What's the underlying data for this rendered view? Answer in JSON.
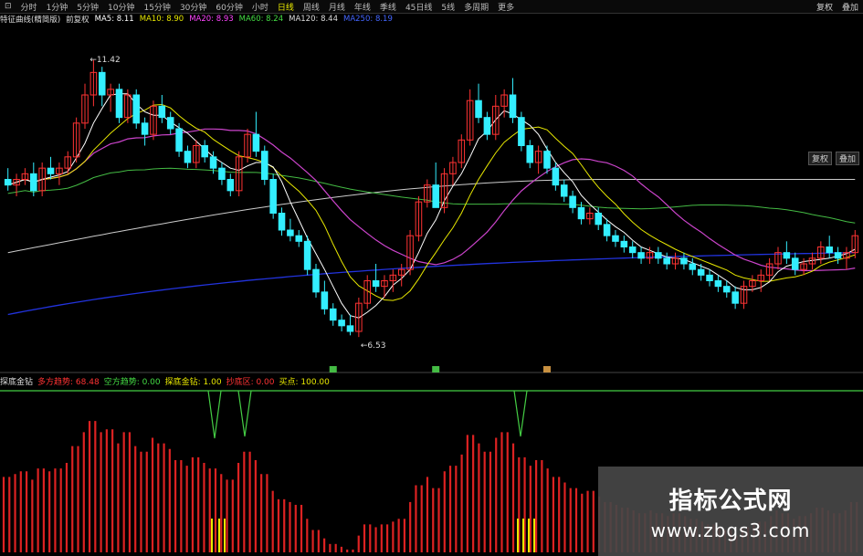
{
  "toolbar": {
    "items": [
      "⊡",
      "分时",
      "1分钟",
      "5分钟",
      "10分钟",
      "15分钟",
      "30分钟",
      "60分钟",
      "小时",
      "日线",
      "周线",
      "月线",
      "年线",
      "季线",
      "45日线",
      "5线",
      "多周期",
      "更多"
    ],
    "active_index": 9,
    "right_buttons": [
      "复权",
      "叠加"
    ]
  },
  "indicator_bar": {
    "items": [
      {
        "text": "特征曲线(精简版)",
        "color": "#dddddd"
      },
      {
        "text": "前复权",
        "color": "#dddddd"
      },
      {
        "text": "MA5: 8.11",
        "color": "#ffffff"
      },
      {
        "text": "MA10: 8.90",
        "color": "#e8e800"
      },
      {
        "text": "MA20: 8.93",
        "color": "#ff44ff"
      },
      {
        "text": "MA60: 8.24",
        "color": "#44dd44"
      },
      {
        "text": "MA120: 8.44",
        "color": "#dddddd"
      },
      {
        "text": "MA250: 8.19",
        "color": "#4466ff"
      }
    ]
  },
  "sub_bar": {
    "items": [
      {
        "text": "探底金钻",
        "color": "#dddddd"
      },
      {
        "text": "多方趋势: 68.48",
        "color": "#ff3333"
      },
      {
        "text": "空方趋势: 0.00",
        "color": "#44dd44"
      },
      {
        "text": "探底金钻: 1.00",
        "color": "#e8e800"
      },
      {
        "text": "抄底区: 0.00",
        "color": "#ff3333"
      },
      {
        "text": "买点: 100.00",
        "color": "#e8e800"
      }
    ]
  },
  "side_buttons": [
    "复权",
    "叠加"
  ],
  "annotations": {
    "high": "11.42",
    "low": "6.53"
  },
  "watermark": {
    "title": "指标公式网",
    "url": "www.zbgs3.com"
  },
  "colors": {
    "up": "#ff3333",
    "down": "#33eeff",
    "ma5": "#ffffff",
    "ma10": "#e8e800",
    "ma20": "#cc44cc",
    "ma60": "#44bb44",
    "ma120": "#cccccc",
    "ma250": "#2233dd",
    "bar": "#dd2222",
    "signal": "#e8e800",
    "topline": "#44cc44"
  },
  "chart_data": {
    "type": "candlestick",
    "price_range": [
      6.0,
      12.0
    ],
    "candles": [
      [
        9.3,
        9.5,
        9.1,
        9.2
      ],
      [
        9.2,
        9.4,
        9.0,
        9.3
      ],
      [
        9.3,
        9.5,
        9.2,
        9.4
      ],
      [
        9.4,
        9.6,
        9.0,
        9.1
      ],
      [
        9.1,
        9.6,
        9.0,
        9.5
      ],
      [
        9.5,
        9.7,
        9.3,
        9.4
      ],
      [
        9.4,
        9.6,
        9.2,
        9.5
      ],
      [
        9.5,
        9.8,
        9.4,
        9.7
      ],
      [
        9.7,
        10.4,
        9.6,
        10.3
      ],
      [
        10.3,
        11.0,
        10.2,
        10.8
      ],
      [
        10.8,
        11.42,
        10.6,
        11.2
      ],
      [
        11.2,
        11.3,
        10.6,
        10.8
      ],
      [
        10.8,
        11.0,
        10.5,
        10.9
      ],
      [
        10.9,
        11.0,
        10.3,
        10.4
      ],
      [
        10.4,
        10.9,
        10.3,
        10.8
      ],
      [
        10.8,
        10.9,
        10.2,
        10.3
      ],
      [
        10.3,
        10.4,
        9.9,
        10.1
      ],
      [
        10.1,
        10.7,
        10.0,
        10.6
      ],
      [
        10.6,
        10.8,
        10.3,
        10.4
      ],
      [
        10.4,
        10.5,
        10.1,
        10.2
      ],
      [
        10.2,
        10.3,
        9.7,
        9.8
      ],
      [
        9.8,
        9.9,
        9.5,
        9.6
      ],
      [
        9.6,
        10.0,
        9.5,
        9.9
      ],
      [
        9.9,
        10.0,
        9.6,
        9.7
      ],
      [
        9.7,
        9.8,
        9.4,
        9.5
      ],
      [
        9.5,
        9.6,
        9.2,
        9.3
      ],
      [
        9.3,
        9.4,
        9.0,
        9.1
      ],
      [
        9.1,
        9.8,
        9.0,
        9.7
      ],
      [
        9.7,
        10.2,
        9.6,
        10.1
      ],
      [
        10.1,
        10.5,
        9.7,
        9.8
      ],
      [
        9.8,
        9.9,
        9.2,
        9.3
      ],
      [
        9.3,
        9.4,
        8.6,
        8.7
      ],
      [
        8.7,
        8.8,
        8.3,
        8.4
      ],
      [
        8.4,
        8.6,
        8.2,
        8.3
      ],
      [
        8.3,
        8.4,
        8.1,
        8.2
      ],
      [
        8.2,
        8.3,
        7.6,
        7.7
      ],
      [
        7.7,
        7.8,
        7.2,
        7.3
      ],
      [
        7.3,
        7.5,
        6.9,
        7.0
      ],
      [
        7.0,
        7.1,
        6.7,
        6.8
      ],
      [
        6.8,
        6.9,
        6.6,
        6.7
      ],
      [
        6.7,
        6.9,
        6.53,
        6.6
      ],
      [
        6.6,
        7.2,
        6.5,
        7.1
      ],
      [
        7.1,
        7.6,
        7.0,
        7.5
      ],
      [
        7.5,
        7.8,
        7.3,
        7.4
      ],
      [
        7.4,
        7.6,
        7.2,
        7.5
      ],
      [
        7.5,
        7.7,
        7.3,
        7.6
      ],
      [
        7.6,
        7.8,
        7.4,
        7.7
      ],
      [
        7.7,
        8.4,
        7.6,
        8.3
      ],
      [
        8.3,
        9.0,
        8.2,
        8.9
      ],
      [
        8.9,
        9.3,
        8.8,
        9.2
      ],
      [
        9.2,
        9.6,
        9.0,
        8.8
      ],
      [
        8.8,
        9.5,
        8.7,
        9.4
      ],
      [
        9.4,
        9.7,
        9.2,
        9.6
      ],
      [
        9.6,
        10.1,
        9.5,
        10.0
      ],
      [
        10.0,
        10.9,
        9.9,
        10.7
      ],
      [
        10.7,
        11.0,
        10.3,
        10.4
      ],
      [
        10.4,
        10.5,
        10.0,
        10.1
      ],
      [
        10.1,
        10.8,
        10.0,
        10.6
      ],
      [
        10.6,
        10.9,
        10.4,
        10.8
      ],
      [
        10.8,
        11.1,
        10.3,
        10.4
      ],
      [
        10.4,
        10.5,
        9.8,
        9.9
      ],
      [
        9.9,
        10.0,
        9.5,
        9.6
      ],
      [
        9.6,
        9.9,
        9.4,
        9.8
      ],
      [
        9.8,
        9.9,
        9.4,
        9.5
      ],
      [
        9.5,
        9.6,
        9.1,
        9.2
      ],
      [
        9.2,
        9.3,
        8.9,
        9.0
      ],
      [
        9.0,
        9.1,
        8.7,
        8.8
      ],
      [
        8.8,
        8.9,
        8.5,
        8.6
      ],
      [
        8.6,
        8.8,
        8.5,
        8.7
      ],
      [
        8.7,
        8.8,
        8.4,
        8.5
      ],
      [
        8.5,
        8.6,
        8.2,
        8.3
      ],
      [
        8.3,
        8.4,
        8.1,
        8.2
      ],
      [
        8.2,
        8.3,
        8.0,
        8.1
      ],
      [
        8.1,
        8.2,
        7.9,
        8.0
      ],
      [
        8.0,
        8.1,
        7.8,
        7.9
      ],
      [
        7.9,
        8.1,
        7.8,
        8.0
      ],
      [
        8.0,
        8.1,
        7.8,
        7.9
      ],
      [
        7.9,
        8.0,
        7.7,
        7.8
      ],
      [
        7.8,
        8.0,
        7.7,
        7.9
      ],
      [
        7.9,
        8.0,
        7.7,
        7.8
      ],
      [
        7.8,
        7.9,
        7.6,
        7.7
      ],
      [
        7.7,
        7.8,
        7.5,
        7.6
      ],
      [
        7.6,
        7.7,
        7.4,
        7.5
      ],
      [
        7.5,
        7.6,
        7.3,
        7.4
      ],
      [
        7.4,
        7.5,
        7.2,
        7.3
      ],
      [
        7.3,
        7.4,
        7.0,
        7.1
      ],
      [
        7.1,
        7.5,
        7.0,
        7.4
      ],
      [
        7.4,
        7.6,
        7.3,
        7.5
      ],
      [
        7.5,
        7.7,
        7.3,
        7.6
      ],
      [
        7.6,
        7.9,
        7.5,
        7.8
      ],
      [
        7.8,
        8.1,
        7.7,
        8.0
      ],
      [
        8.0,
        8.2,
        7.8,
        7.9
      ],
      [
        7.9,
        8.0,
        7.6,
        7.7
      ],
      [
        7.7,
        7.9,
        7.6,
        7.8
      ],
      [
        7.8,
        8.0,
        7.7,
        7.9
      ],
      [
        7.9,
        8.2,
        7.8,
        8.1
      ],
      [
        8.1,
        8.3,
        7.9,
        8.0
      ],
      [
        8.0,
        8.1,
        7.8,
        7.9
      ],
      [
        7.9,
        8.1,
        7.7,
        8.0
      ],
      [
        8.0,
        8.4,
        7.9,
        8.3
      ]
    ],
    "volume_like_histogram_values": []
  }
}
